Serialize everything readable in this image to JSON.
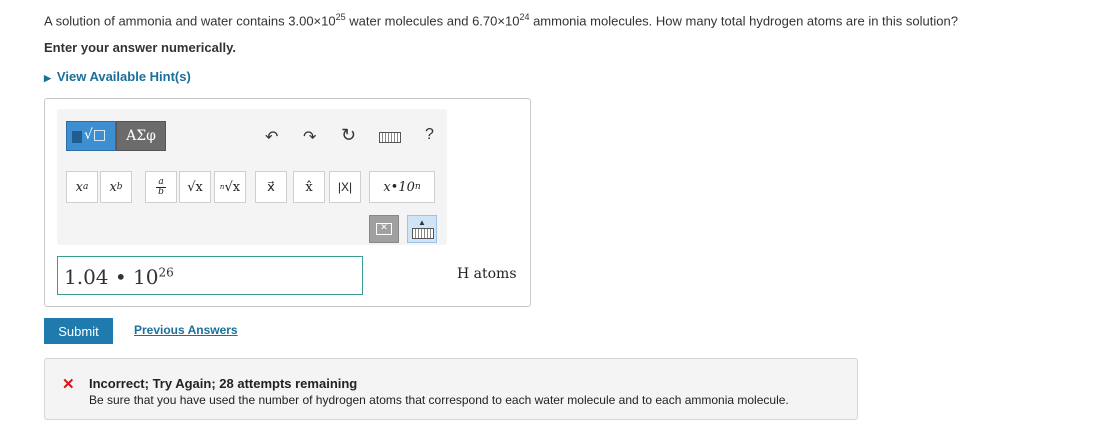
{
  "question": {
    "part1": "A solution of ammonia and water contains 3.00×10",
    "exp1": "25",
    "part2": " water molecules and 6.70×10",
    "exp2": "24",
    "part3": " ammonia molecules. How many total hydrogen atoms are in this solution?"
  },
  "instruction": "Enter your answer numerically.",
  "hints_label": "View Available Hint(s)",
  "toolbar": {
    "template_icon": "radical-template-icon",
    "greek_label": "ΑΣφ",
    "undo_icon": "undo-arrow-icon",
    "redo_icon": "redo-arrow-icon",
    "reset_icon": "reset-icon",
    "keyboard_icon": "keyboard-icon",
    "help_label": "?"
  },
  "keys": {
    "sup_base": "x",
    "sup_exp": "a",
    "sub_base": "x",
    "sub_idx": "b",
    "frac_num": "a",
    "frac_den": "b",
    "sqrt": "√x",
    "nroot_idx": "n",
    "nroot": "√x",
    "vec": "x⃗",
    "hat": "x̂",
    "abs": "|X|",
    "sci_base": "x•10",
    "sci_exp": "n"
  },
  "answer": {
    "mantissa": "1.04 • 10",
    "exponent": "26"
  },
  "units": "H atoms",
  "submit_label": "Submit",
  "previous_answers_label": "Previous Answers",
  "feedback": {
    "icon": "✕",
    "title": "Incorrect; Try Again; 28 attempts remaining",
    "message": "Be sure that you have used the number of hydrogen atoms that correspond to each water molecule and to each ammonia molecule."
  },
  "colors": {
    "accent": "#1f7aad",
    "link": "#1a6f9b",
    "error": "#d0181b",
    "input_border": "#3a9b8e"
  }
}
